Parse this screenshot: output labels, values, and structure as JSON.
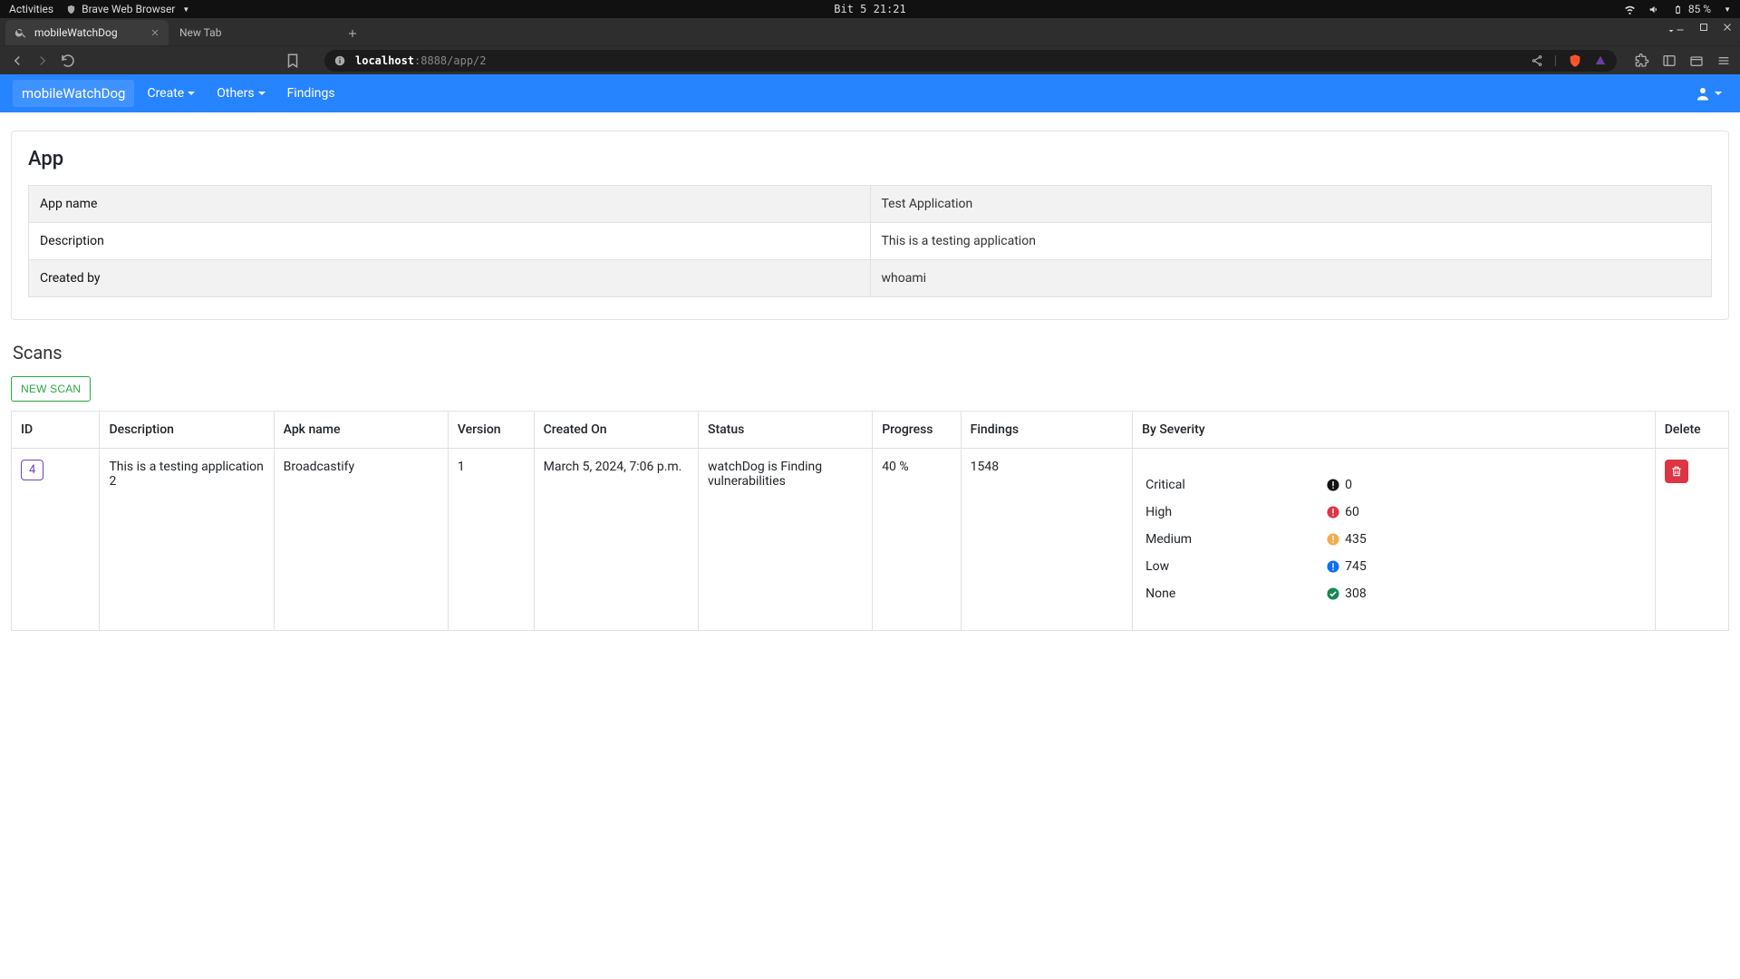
{
  "os": {
    "activities": "Activities",
    "browser_name": "Brave Web Browser",
    "clock": "Bit 5 21:21",
    "battery": "85 %"
  },
  "tabs": {
    "active_title": "mobileWatchDog",
    "inactive_title": "New Tab"
  },
  "url": {
    "host": "localhost",
    "port_path": ":8888/app/2"
  },
  "nav": {
    "brand": "mobileWatchDog",
    "create": "Create",
    "others": "Others",
    "findings": "Findings"
  },
  "app_section": {
    "heading": "App",
    "rows": {
      "name_label": "App name",
      "name_value": "Test Application",
      "desc_label": "Description",
      "desc_value": "This is a testing application",
      "creator_label": "Created by",
      "creator_value": "whoami"
    }
  },
  "scans": {
    "heading": "Scans",
    "new_scan_btn": "NEW SCAN",
    "headers": {
      "id": "ID",
      "desc": "Description",
      "apk": "Apk name",
      "ver": "Version",
      "created": "Created On",
      "status": "Status",
      "progress": "Progress",
      "findings": "Findings",
      "severity": "By Severity",
      "delete": "Delete"
    },
    "row": {
      "id": "4",
      "desc": "This is a testing application 2",
      "apk": "Broadcastify",
      "ver": "1",
      "created": "March 5, 2024, 7:06 p.m.",
      "status": "watchDog is Finding vulnerabilities",
      "progress": "40 %",
      "findings": "1548",
      "severity": {
        "critical_label": "Critical",
        "critical_count": "0",
        "high_label": "High",
        "high_count": "60",
        "medium_label": "Medium",
        "medium_count": "435",
        "low_label": "Low",
        "low_count": "745",
        "none_label": "None",
        "none_count": "308"
      }
    }
  },
  "colors": {
    "critical": "#111111",
    "high": "#dc3545",
    "medium": "#f0ad4e",
    "low": "#0d6efd",
    "none": "#198754"
  }
}
